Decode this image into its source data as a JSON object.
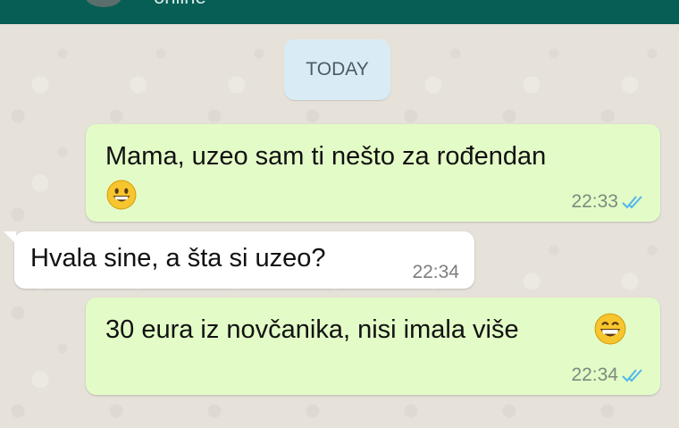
{
  "header": {
    "status": "online"
  },
  "date_chip": "TODAY",
  "messages": [
    {
      "direction": "outgoing",
      "line1": "Mama, uzeo sam ti nešto za rođendan",
      "emoji": "grinning-face",
      "time": "22:33",
      "ticks": "double-blue"
    },
    {
      "direction": "incoming",
      "text": "Hvala sine, a šta si uzeo?",
      "time": "22:34"
    },
    {
      "direction": "outgoing",
      "text": "30 eura iz novčanika, nisi imala više",
      "emoji": "grinning-face-with-big-eyes",
      "time": "22:34",
      "ticks": "double-blue"
    }
  ],
  "colors": {
    "header": "#075e54",
    "outgoing_bubble": "#e3fcc7",
    "incoming_bubble": "#ffffff",
    "date_chip": "#d9ecf5",
    "read_ticks": "#4fb6ec"
  }
}
